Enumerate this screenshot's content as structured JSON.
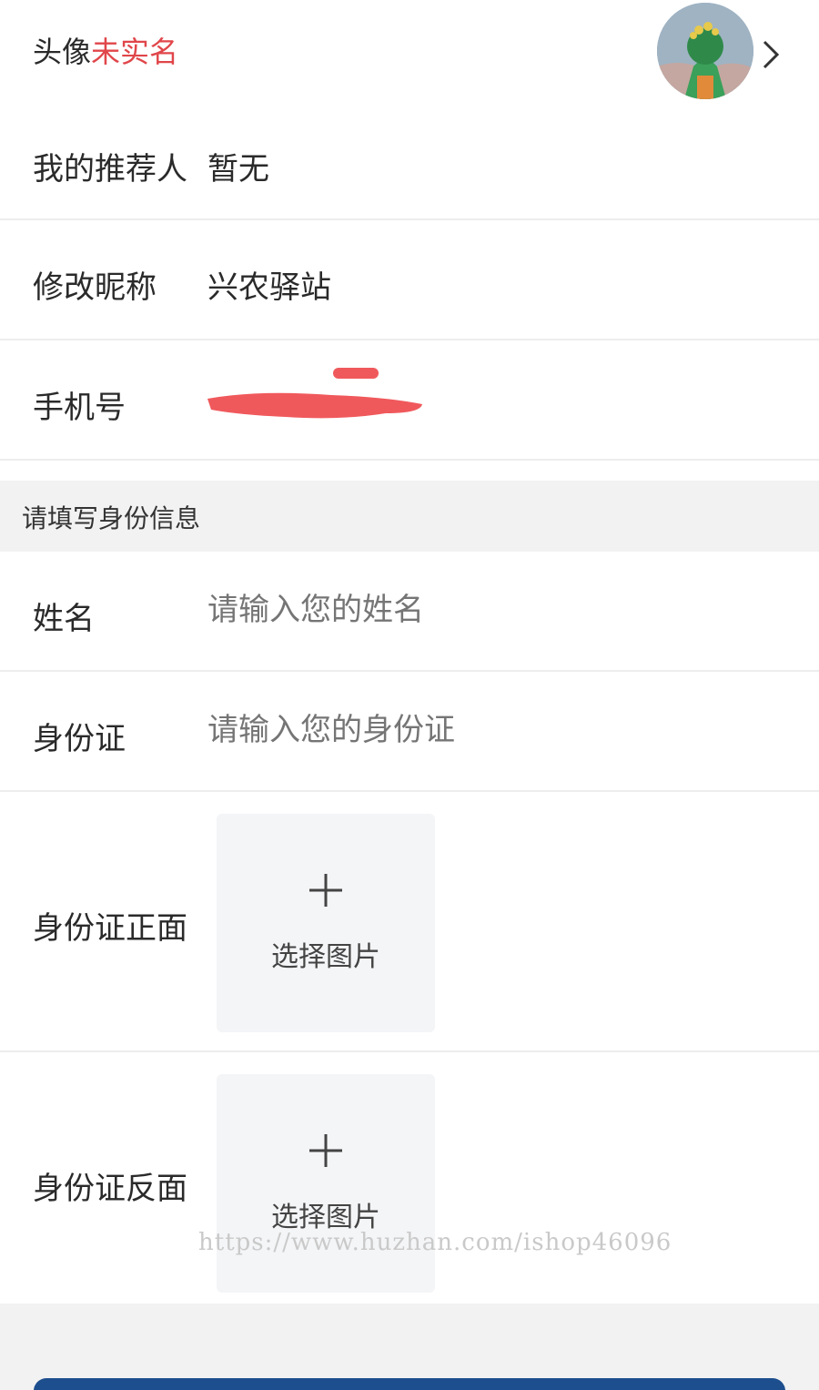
{
  "profile": {
    "avatar_label": "头像",
    "verify_status": "未实名",
    "referrer_label": "我的推荐人",
    "referrer_value": "暂无",
    "nickname_label": "修改昵称",
    "nickname_value": "兴农驿站",
    "phone_label": "手机号"
  },
  "identity": {
    "section_title": "请填写身份信息",
    "name_label": "姓名",
    "name_placeholder": "请输入您的姓名",
    "id_label": "身份证",
    "id_placeholder": "请输入您的身份证",
    "front_label": "身份证正面",
    "back_label": "身份证反面",
    "upload_label": "选择图片"
  },
  "watermark": "https://www.huzhan.com/ishop46096",
  "colors": {
    "status_red": "#e0464a",
    "redaction": "#f0595c",
    "submit_blue": "#1d4f8f",
    "placeholder_gray": "#a8a8a8"
  },
  "icons": {
    "chevron": "chevron-right-icon",
    "plus": "plus-icon"
  }
}
